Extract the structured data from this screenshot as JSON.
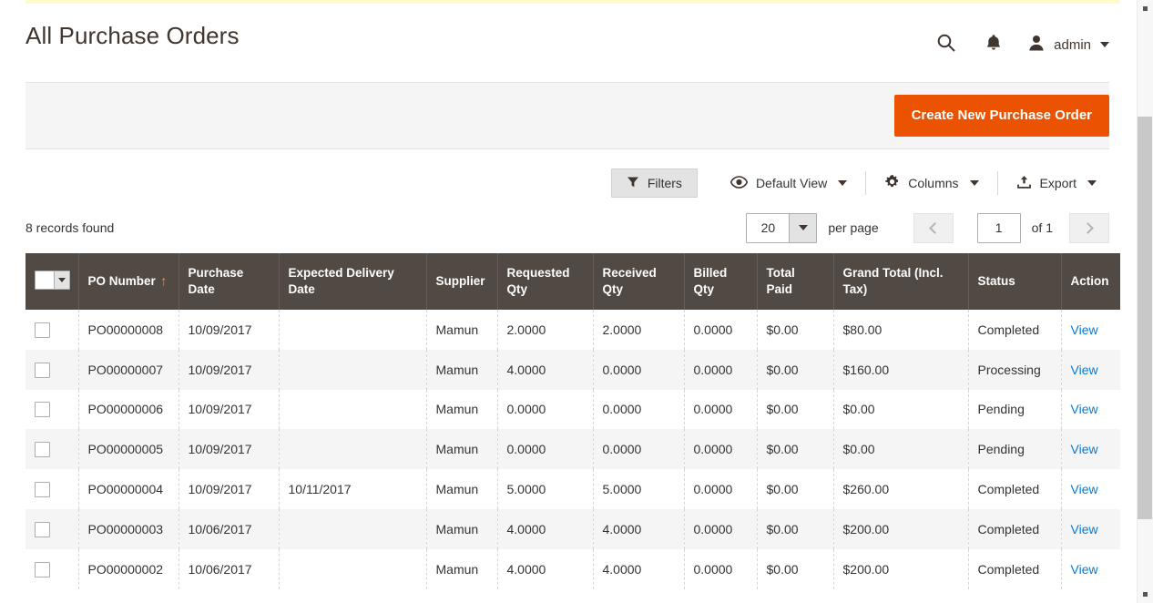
{
  "header": {
    "title": "All Purchase Orders",
    "search_icon": "search-icon",
    "notifications_icon": "bell-icon",
    "avatar_icon": "user-avatar-icon",
    "username": "admin"
  },
  "action_bar": {
    "create_label": "Create New Purchase Order",
    "accent_color": "#eb5202"
  },
  "toolbar": {
    "filters_label": "Filters",
    "filters_icon": "funnel-icon",
    "view_label": "Default View",
    "view_icon": "eye-icon",
    "columns_label": "Columns",
    "columns_icon": "gear-icon",
    "export_label": "Export",
    "export_icon": "export-upload-icon"
  },
  "grid_meta": {
    "records_found": "8 records found",
    "per_page_value": "20",
    "per_page_label": "per page",
    "page_value": "1",
    "of_pages": "of 1",
    "prev_icon": "chevron-left-icon",
    "next_icon": "chevron-right-icon"
  },
  "table": {
    "header_bg": "#514943",
    "sort_indicator": "↑",
    "sort_column": "PO Number",
    "columns": [
      {
        "label": "",
        "key": "check"
      },
      {
        "label": "PO Number",
        "key": "po_number"
      },
      {
        "label": "Purchase Date",
        "key": "purchase_date"
      },
      {
        "label": "Expected Delivery Date",
        "key": "expected_delivery_date"
      },
      {
        "label": "Supplier",
        "key": "supplier"
      },
      {
        "label": "Requested Qty",
        "key": "requested_qty"
      },
      {
        "label": "Received Qty",
        "key": "received_qty"
      },
      {
        "label": "Billed Qty",
        "key": "billed_qty"
      },
      {
        "label": "Total Paid",
        "key": "total_paid"
      },
      {
        "label": "Grand Total (Incl. Tax)",
        "key": "grand_total"
      },
      {
        "label": "Status",
        "key": "status"
      },
      {
        "label": "Action",
        "key": "action"
      }
    ],
    "action_label": "View",
    "rows": [
      {
        "po_number": "PO00000008",
        "purchase_date": "10/09/2017",
        "expected_delivery_date": "",
        "supplier": "Mamun",
        "requested_qty": "2.0000",
        "received_qty": "2.0000",
        "billed_qty": "0.0000",
        "total_paid": "$0.00",
        "grand_total": "$80.00",
        "status": "Completed",
        "action": "View"
      },
      {
        "po_number": "PO00000007",
        "purchase_date": "10/09/2017",
        "expected_delivery_date": "",
        "supplier": "Mamun",
        "requested_qty": "4.0000",
        "received_qty": "0.0000",
        "billed_qty": "0.0000",
        "total_paid": "$0.00",
        "grand_total": "$160.00",
        "status": "Processing",
        "action": "View"
      },
      {
        "po_number": "PO00000006",
        "purchase_date": "10/09/2017",
        "expected_delivery_date": "",
        "supplier": "Mamun",
        "requested_qty": "0.0000",
        "received_qty": "0.0000",
        "billed_qty": "0.0000",
        "total_paid": "$0.00",
        "grand_total": "$0.00",
        "status": "Pending",
        "action": "View"
      },
      {
        "po_number": "PO00000005",
        "purchase_date": "10/09/2017",
        "expected_delivery_date": "",
        "supplier": "Mamun",
        "requested_qty": "0.0000",
        "received_qty": "0.0000",
        "billed_qty": "0.0000",
        "total_paid": "$0.00",
        "grand_total": "$0.00",
        "status": "Pending",
        "action": "View"
      },
      {
        "po_number": "PO00000004",
        "purchase_date": "10/09/2017",
        "expected_delivery_date": "10/11/2017",
        "supplier": "Mamun",
        "requested_qty": "5.0000",
        "received_qty": "5.0000",
        "billed_qty": "0.0000",
        "total_paid": "$0.00",
        "grand_total": "$260.00",
        "status": "Completed",
        "action": "View"
      },
      {
        "po_number": "PO00000003",
        "purchase_date": "10/06/2017",
        "expected_delivery_date": "",
        "supplier": "Mamun",
        "requested_qty": "4.0000",
        "received_qty": "4.0000",
        "billed_qty": "0.0000",
        "total_paid": "$0.00",
        "grand_total": "$200.00",
        "status": "Completed",
        "action": "View"
      },
      {
        "po_number": "PO00000002",
        "purchase_date": "10/06/2017",
        "expected_delivery_date": "",
        "supplier": "Mamun",
        "requested_qty": "4.0000",
        "received_qty": "4.0000",
        "billed_qty": "0.0000",
        "total_paid": "$0.00",
        "grand_total": "$200.00",
        "status": "Completed",
        "action": "View"
      }
    ]
  }
}
